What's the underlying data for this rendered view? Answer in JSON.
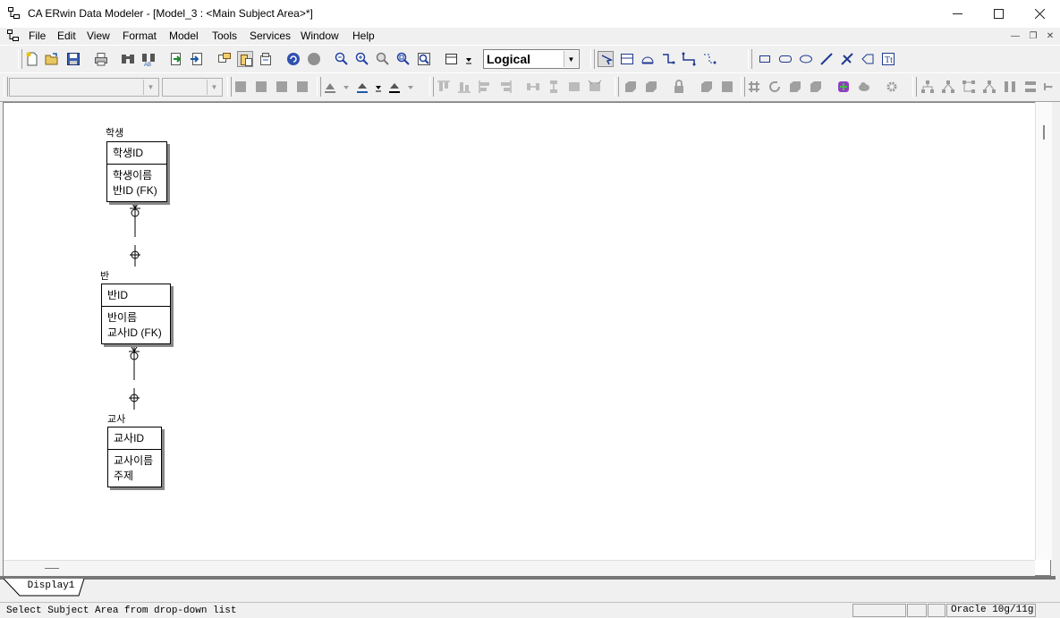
{
  "window": {
    "title": "CA ERwin Data Modeler - [Model_3 : <Main Subject Area>*]",
    "minimize_icon": "minimize-icon",
    "maximize_icon": "maximize-icon",
    "close_icon": "close-icon"
  },
  "menu": {
    "items": [
      "File",
      "Edit",
      "View",
      "Format",
      "Model",
      "Tools",
      "Services",
      "Window",
      "Help"
    ]
  },
  "toolbar": {
    "display_level": "Logical",
    "font_name": "",
    "font_size": ""
  },
  "diagram": {
    "entities": [
      {
        "name": "학생",
        "pk": "학생ID",
        "attrs": [
          "학생이름",
          "반ID (FK)"
        ]
      },
      {
        "name": "반",
        "pk": "반ID",
        "attrs": [
          "반이름",
          "교사ID (FK)"
        ]
      },
      {
        "name": "교사",
        "pk": "교사ID",
        "attrs": [
          "교사이름",
          "주제"
        ]
      }
    ]
  },
  "tabs": {
    "active": "Display1"
  },
  "status": {
    "message": "Select Subject Area from drop-down list",
    "target_db": "Oracle 10g/11g"
  },
  "colors": {
    "accent_blue": "#1e5aa8",
    "canvas": "#ffffff",
    "chrome": "#f0f0f0"
  }
}
